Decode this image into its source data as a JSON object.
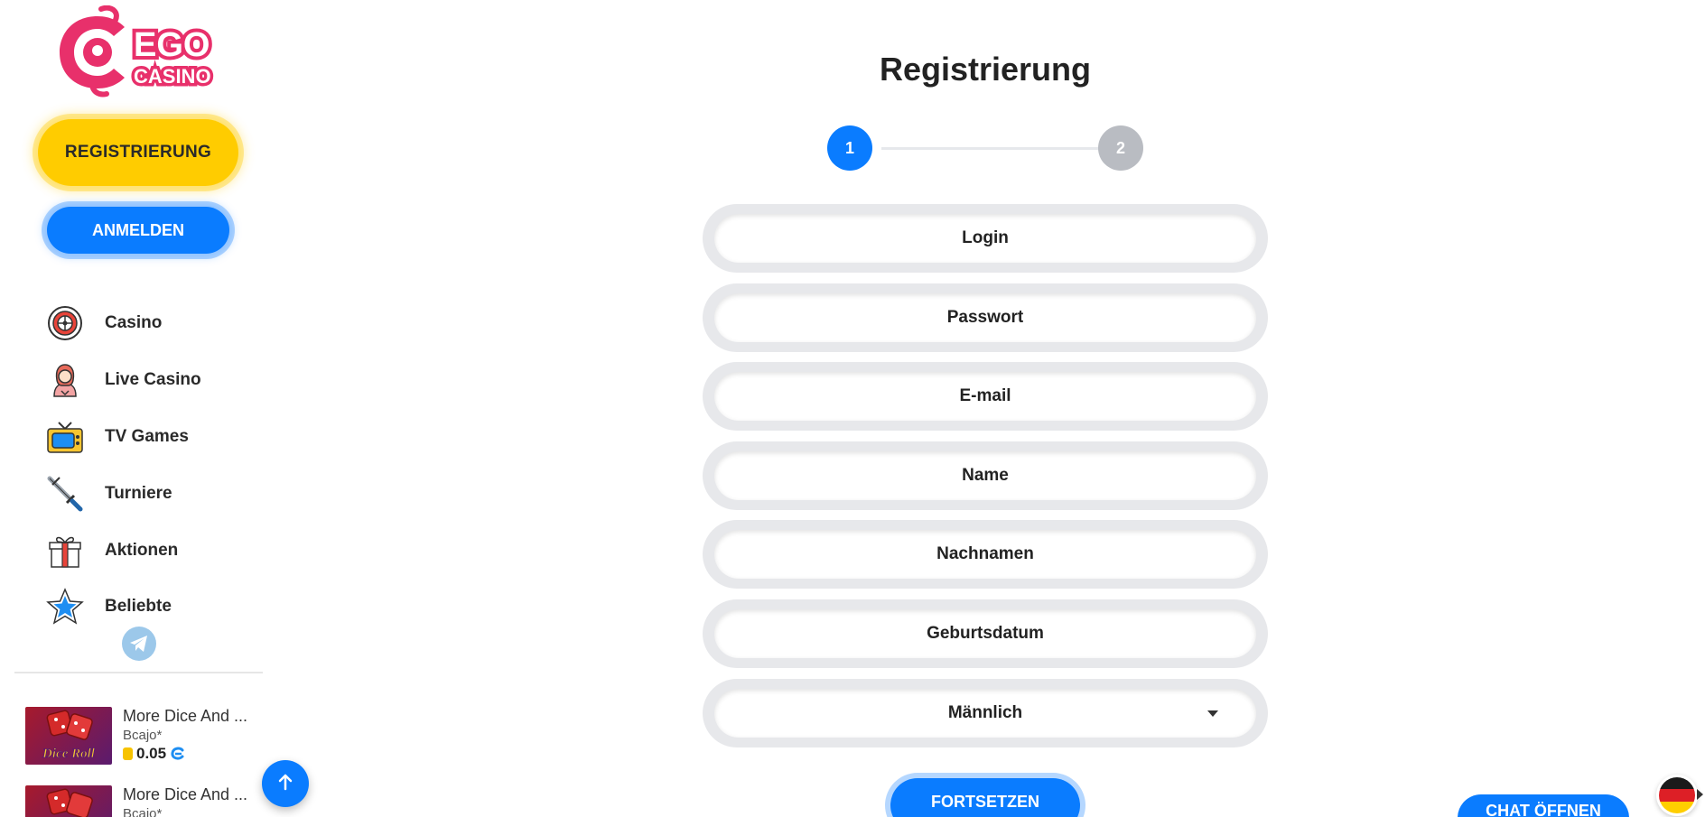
{
  "brand": {
    "logo_text_top": "EGO",
    "logo_text_bottom": "CASINO",
    "logo_color": "#e8306b"
  },
  "sidebar": {
    "register_label": "REGISTRIERUNG",
    "login_label": "ANMELDEN",
    "items": [
      {
        "label": "Casino",
        "icon": "roulette-icon"
      },
      {
        "label": "Live Casino",
        "icon": "dealer-icon"
      },
      {
        "label": "TV Games",
        "icon": "tv-icon"
      },
      {
        "label": "Turniere",
        "icon": "swords-icon"
      },
      {
        "label": "Aktionen",
        "icon": "gift-icon"
      },
      {
        "label": "Beliebte",
        "icon": "star-icon"
      }
    ],
    "telegram_icon": "telegram-icon",
    "recent_wins": [
      {
        "game": "More Dice And ...",
        "user": "Bcajo*",
        "amount": "0.05",
        "thumb_text": "Dice Roll"
      },
      {
        "game": "More Dice And ...",
        "user": "Bcajo*"
      }
    ]
  },
  "main": {
    "title": "Registrierung",
    "steps": [
      "1",
      "2"
    ],
    "active_step": 1,
    "fields": {
      "login": "Login",
      "password": "Passwort",
      "email": "E-mail",
      "name": "Name",
      "surname": "Nachnamen",
      "birthdate": "Geburtsdatum"
    },
    "gender_select": {
      "value": "Männlich"
    },
    "continue_label": "FORTSETZEN"
  },
  "chat_label": "CHAT ÖFFNEN",
  "language": {
    "flag": "de-flag-icon"
  },
  "colors": {
    "accent_blue": "#0a7cff",
    "register_yellow": "#ffcc00",
    "step_inactive": "#b9bcc2"
  }
}
